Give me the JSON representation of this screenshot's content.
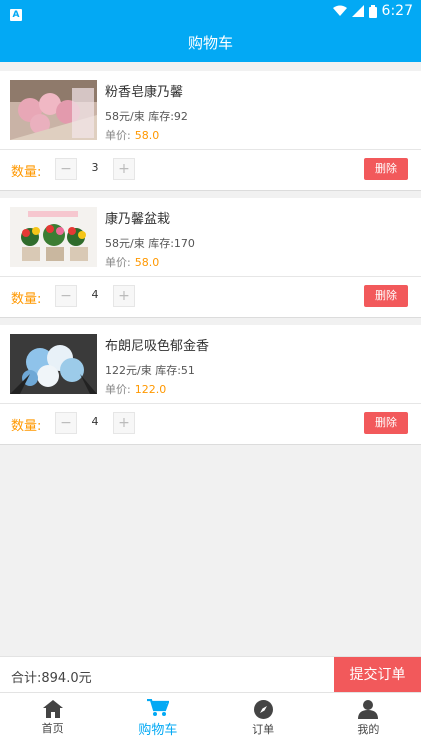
{
  "status_bar": {
    "app_badge": "A",
    "time": "6:27"
  },
  "app_bar": {
    "title": "购物车"
  },
  "cart": {
    "qty_label": "数量:",
    "price_label": "单价:",
    "delete_label": "删除",
    "minus": "−",
    "plus": "+",
    "items": [
      {
        "name": "粉香皂康乃馨",
        "meta": "58元/束 库存:92",
        "price": "58.0",
        "qty": "3",
        "thumb": "pink-soap-carnation-bouquet"
      },
      {
        "name": "康乃馨盆栽",
        "meta": "58元/束 库存:170",
        "price": "58.0",
        "qty": "4",
        "thumb": "potted-carnations"
      },
      {
        "name": "布朗尼吸色郁金香",
        "meta": "122元/束 库存:51",
        "price": "122.0",
        "qty": "4",
        "thumb": "blue-white-bouquet"
      }
    ]
  },
  "footer": {
    "total": "合计:894.0元",
    "submit_label": "提交订单"
  },
  "nav": {
    "items": [
      {
        "label": "首页",
        "icon": "home-icon"
      },
      {
        "label": "购物车",
        "icon": "cart-icon"
      },
      {
        "label": "订单",
        "icon": "compass-icon"
      },
      {
        "label": "我的",
        "icon": "person-icon"
      }
    ],
    "active_index": 1
  },
  "colors": {
    "primary": "#03a9f4",
    "accent": "#ff9800",
    "danger": "#f2595b"
  }
}
